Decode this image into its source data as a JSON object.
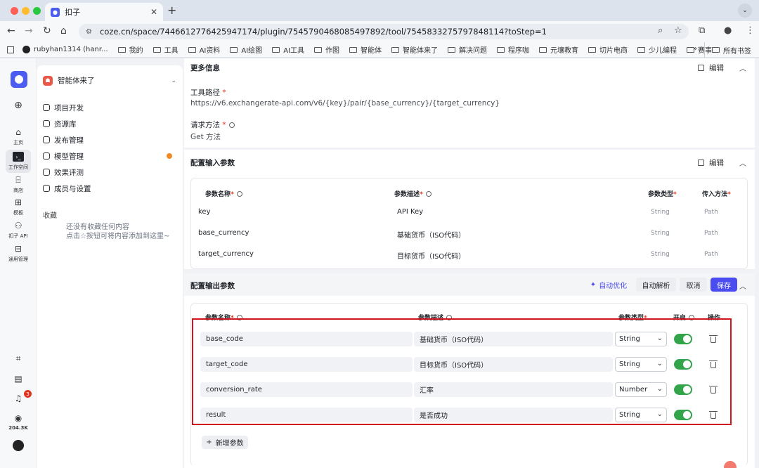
{
  "browser": {
    "tab_title": "扣子",
    "url": "coze.cn/space/7446612776425947174/plugin/7545790468085497892/tool/7545833275797848114?toStep=1",
    "bookmarks": [
      "rubyhan1314 (hanr...",
      "我的",
      "工具",
      "AI资料",
      "AI绘图",
      "AI工具",
      "作图",
      "智能体",
      "智能体来了",
      "解决问题",
      "程序咖",
      "元壤教育",
      "切片电商",
      "少儿编程",
      "赛事"
    ],
    "bookmarks_more": "»",
    "bookmarks_all": "所有书签"
  },
  "rail": {
    "items": [
      {
        "label": "主页"
      },
      {
        "label": "工作空间"
      },
      {
        "label": "商店"
      },
      {
        "label": "模板"
      },
      {
        "label": "扣子 API"
      },
      {
        "label": "通用管理"
      }
    ],
    "notif_count": "3",
    "stars": "204.3K"
  },
  "sidebar": {
    "space_name": "智能体来了",
    "menu": [
      "项目开发",
      "资源库",
      "发布管理",
      "模型管理",
      "效果评测",
      "成员与设置"
    ],
    "favorites_title": "收藏",
    "favorites_empty_1": "还没有收藏任何内容",
    "favorites_empty_2": "点击☆按钮可将内容添加到这里~"
  },
  "more_info": {
    "title": "更多信息",
    "edit": "编辑",
    "path_label": "工具路径",
    "path_value": "https://v6.exchangerate-api.com/v6/{key}/pair/{base_currency}/{target_currency}",
    "method_label": "请求方法",
    "method_value": "Get 方法"
  },
  "input_params": {
    "title": "配置输入参数",
    "edit": "编辑",
    "headers": [
      "参数名称",
      "参数描述",
      "参数类型",
      "传入方法"
    ],
    "rows": [
      {
        "name": "key",
        "desc": "API Key",
        "type": "String",
        "method": "Path"
      },
      {
        "name": "base_currency",
        "desc": "基础货币（ISO代码）",
        "type": "String",
        "method": "Path"
      },
      {
        "name": "target_currency",
        "desc": "目标货币（ISO代码）",
        "type": "String",
        "method": "Path"
      }
    ]
  },
  "output_params": {
    "title": "配置输出参数",
    "auto_optimize": "自动优化",
    "auto_parse": "自动解析",
    "cancel": "取消",
    "save": "保存",
    "headers": [
      "参数名称",
      "参数描述",
      "参数类型",
      "开启",
      "操作"
    ],
    "rows": [
      {
        "name": "base_code",
        "desc": "基础货币（ISO代码）",
        "type": "String",
        "enabled": true
      },
      {
        "name": "target_code",
        "desc": "目标货币（ISO代码）",
        "type": "String",
        "enabled": true
      },
      {
        "name": "conversion_rate",
        "desc": "汇率",
        "type": "Number",
        "enabled": true
      },
      {
        "name": "result",
        "desc": "是否成功",
        "type": "String",
        "enabled": true
      }
    ],
    "add_param": "新增参数"
  },
  "colors": {
    "accent": "#4b4cf0",
    "toggle_on": "#32a44a",
    "highlight": "#d0151f",
    "required": "#e0341f"
  }
}
